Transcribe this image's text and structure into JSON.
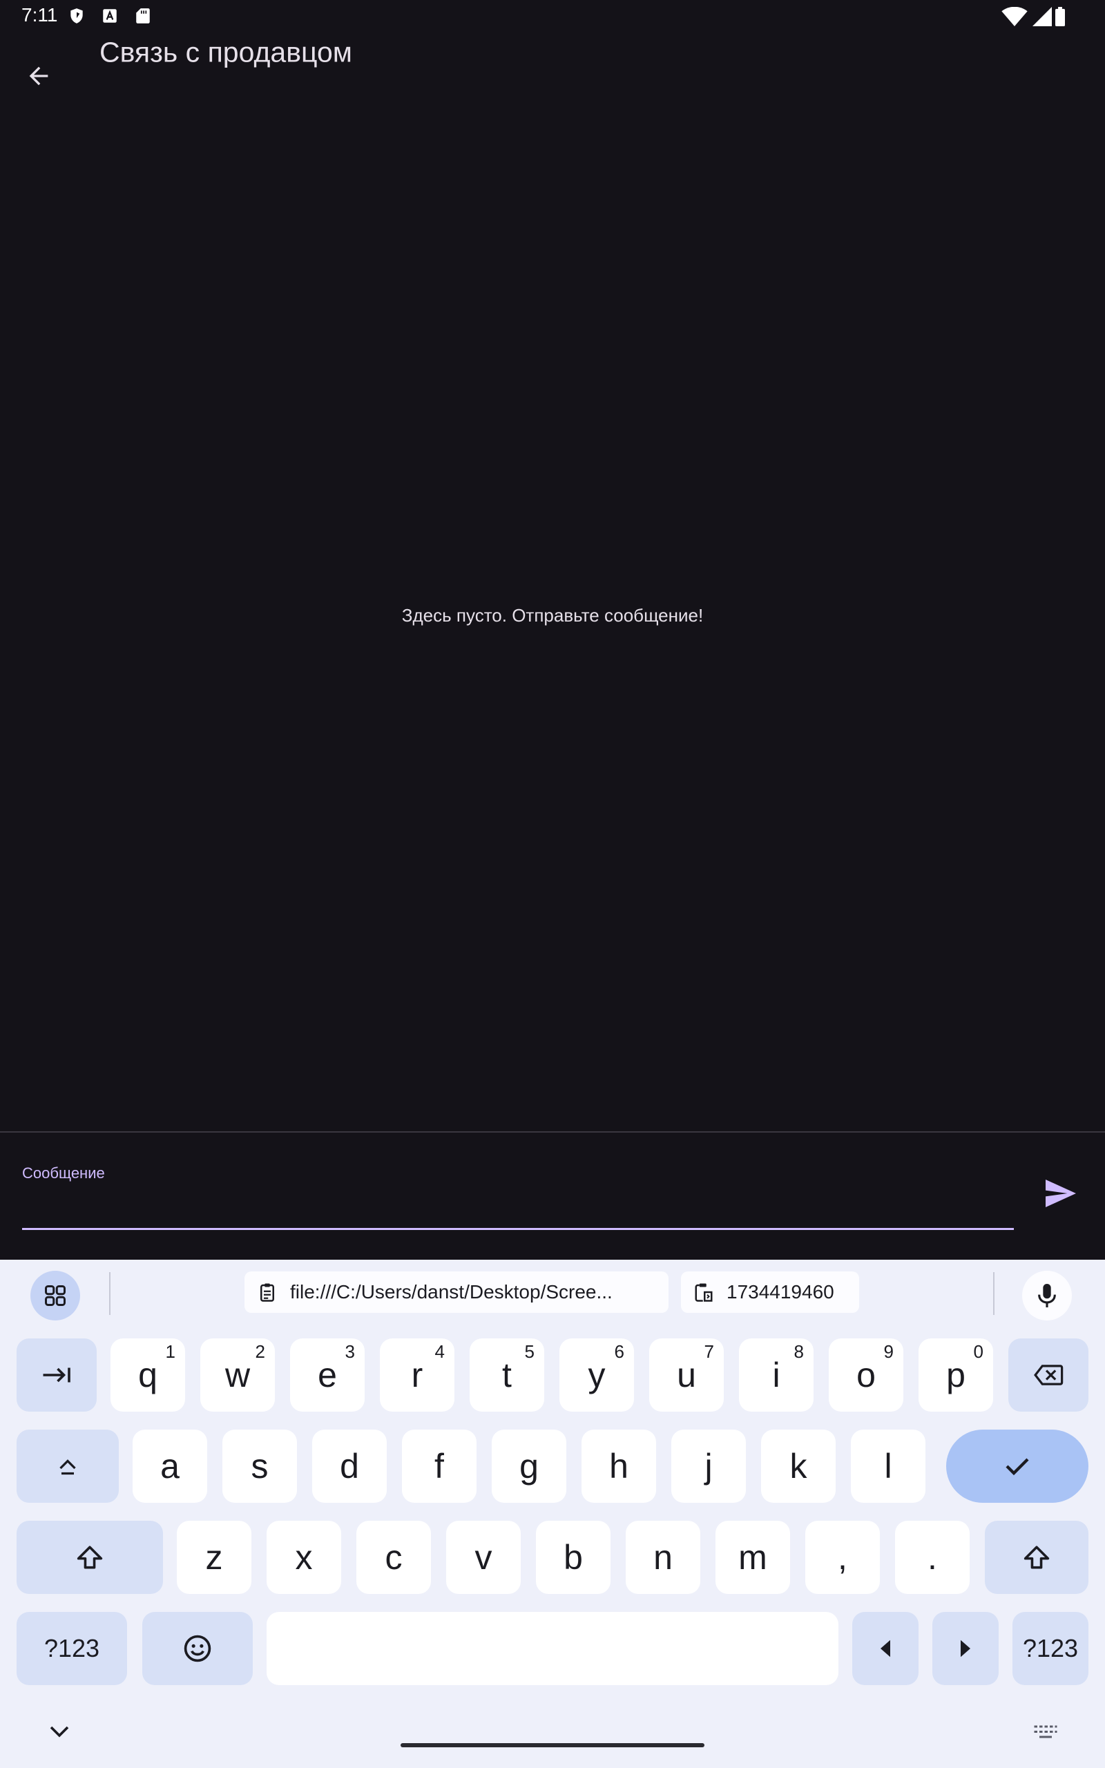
{
  "status_bar": {
    "time": "7:11",
    "left_icons": [
      "shield-icon",
      "a-box-icon",
      "sd-card-icon"
    ],
    "right_icons": [
      "wifi-icon",
      "signal-icon",
      "battery-icon"
    ]
  },
  "app_bar": {
    "title": "Связь с продавцом",
    "back_icon": "arrow-back-icon"
  },
  "main": {
    "empty_message": "Здесь пусто. Отправьте сообщение!"
  },
  "composer": {
    "label": "Сообщение",
    "value": "",
    "send_icon": "send-icon",
    "accent": "#d0bcff"
  },
  "keyboard": {
    "toolbar": {
      "clipboard_text": "file:///C:/Users/danst/Desktop/Scree...",
      "clipboard_number": "1734419460"
    },
    "row1": [
      {
        "label": "q",
        "hint": "1"
      },
      {
        "label": "w",
        "hint": "2"
      },
      {
        "label": "e",
        "hint": "3"
      },
      {
        "label": "r",
        "hint": "4"
      },
      {
        "label": "t",
        "hint": "5"
      },
      {
        "label": "y",
        "hint": "6"
      },
      {
        "label": "u",
        "hint": "7"
      },
      {
        "label": "i",
        "hint": "8"
      },
      {
        "label": "o",
        "hint": "9"
      },
      {
        "label": "p",
        "hint": "0"
      }
    ],
    "row2": [
      "a",
      "s",
      "d",
      "f",
      "g",
      "h",
      "j",
      "k",
      "l"
    ],
    "row3": [
      "z",
      "x",
      "c",
      "v",
      "b",
      "n",
      "m",
      ",",
      "."
    ],
    "symbols_label": "?123",
    "colors": {
      "background": "#eef0fa",
      "key": "#ffffff",
      "function_key": "#d7e0f6",
      "enter_key": "#a9c3f5"
    }
  }
}
